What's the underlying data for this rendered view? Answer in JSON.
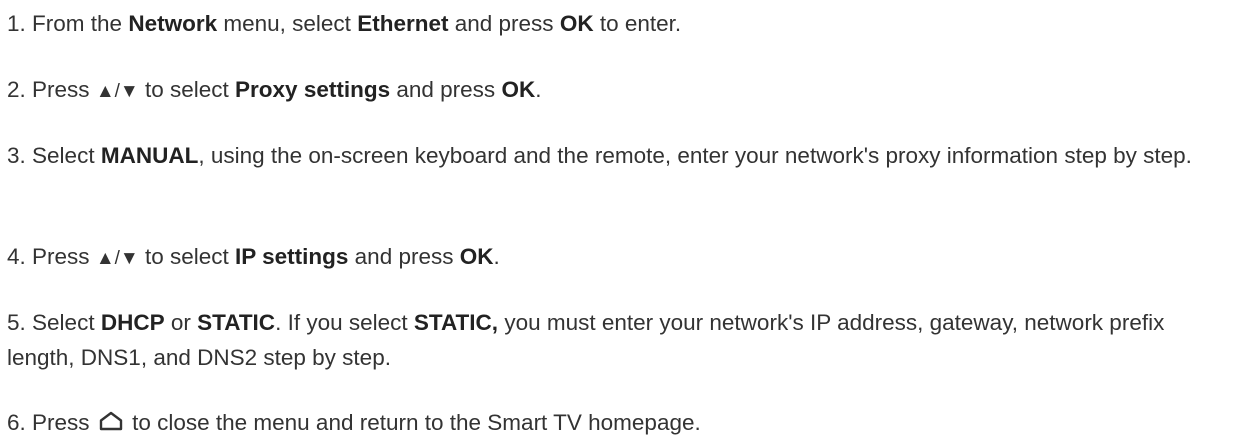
{
  "steps": [
    {
      "num": "1.",
      "parts": [
        "From the",
        "Network",
        "menu, select",
        "Ethernet",
        "and press",
        "OK",
        "to enter."
      ]
    },
    {
      "num": "2.",
      "parts": [
        "Press",
        "▲/▼",
        "to select",
        "Proxy settings",
        "and press",
        "OK",
        "."
      ]
    },
    {
      "num": "3.",
      "parts": [
        "Select",
        "MANUAL",
        ", using the on-screen keyboard and the remote, enter your network's proxy information step by step."
      ]
    },
    {
      "num": "4.",
      "parts": [
        "Press",
        "▲/▼",
        "to select",
        "IP settings",
        "and press",
        "OK",
        "."
      ]
    },
    {
      "num": "5.",
      "parts": [
        "Select",
        "DHCP",
        "or",
        "STATIC",
        ". If you select",
        "STATIC,",
        "you must enter your network's IP address, gateway, network prefix length, DNS1, and DNS2 step by step."
      ]
    },
    {
      "num": "6.",
      "parts": [
        "Press",
        "to close the menu and return to the Smart TV homepage."
      ],
      "icon": "home-icon"
    }
  ]
}
